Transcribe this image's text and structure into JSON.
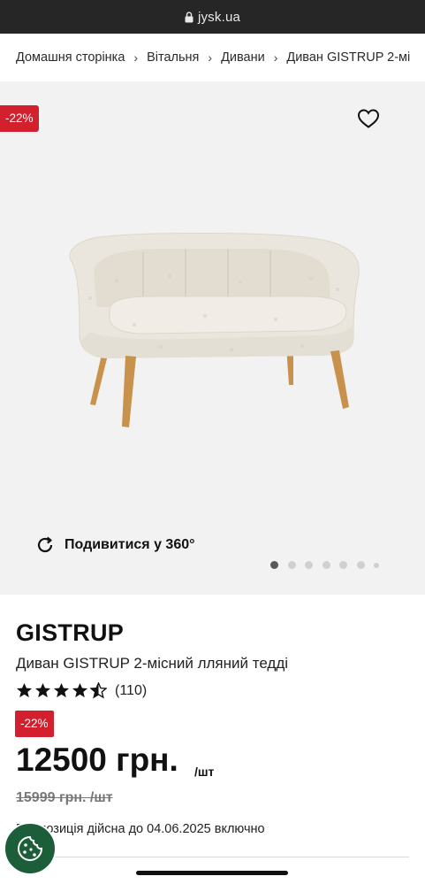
{
  "browser": {
    "url": "jysk.ua"
  },
  "breadcrumb": {
    "items": [
      "Домашня сторінка",
      "Вітальня",
      "Дивани",
      "Диван GISTRUP 2-мі"
    ]
  },
  "gallery": {
    "discount_badge": "-22%",
    "view360_label": "Подивитися у 360°",
    "slides_total": 7,
    "active_slide": 1
  },
  "product": {
    "brand": "GISTRUP",
    "name": "Диван GISTRUP 2-місний лляний тедді",
    "rating": 4.5,
    "rating_count": "(110)",
    "discount_badge": "-22%",
    "price": "12500 грн.",
    "price_unit": "/шт",
    "old_price": "15999 грн. /шт",
    "offer_note": "Пропозиція дійсна до 04.06.2025 включно"
  },
  "colors": {
    "sale_badge": "#d3202e",
    "cookie_button": "#1d5e3a",
    "gallery_bg": "#f2f2f2",
    "url_bar": "#262626"
  },
  "icons": {
    "lock": "lock-icon",
    "wishlist": "heart-icon",
    "rotate": "rotate-360-icon",
    "cookie": "cookie-icon"
  }
}
